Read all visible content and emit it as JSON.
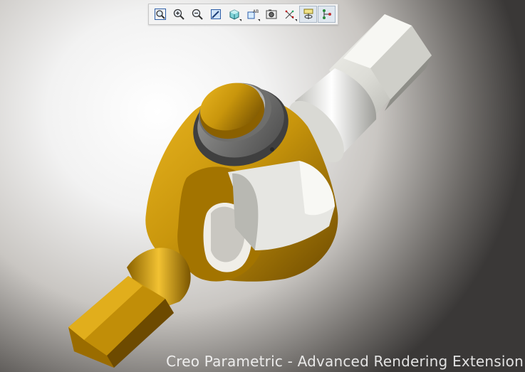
{
  "toolbar": {
    "buttons": [
      {
        "name": "refit-icon",
        "active": false,
        "dropdown": false
      },
      {
        "name": "zoom-in-icon",
        "active": false,
        "dropdown": false
      },
      {
        "name": "zoom-out-icon",
        "active": false,
        "dropdown": false
      },
      {
        "name": "repaint-icon",
        "active": false,
        "dropdown": false
      },
      {
        "name": "display-style-icon",
        "active": false,
        "dropdown": true
      },
      {
        "name": "saved-orientations-icon",
        "active": false,
        "dropdown": true
      },
      {
        "name": "view-manager-icon",
        "active": false,
        "dropdown": false
      },
      {
        "name": "datum-display-icon",
        "active": false,
        "dropdown": true
      },
      {
        "name": "spin-center-icon",
        "active": true,
        "dropdown": false
      },
      {
        "name": "mechanism-connections-icon",
        "active": true,
        "dropdown": false
      }
    ]
  },
  "watermark": "Creo Parametric - Advanced Rendering Extension",
  "colors": {
    "gold": "#c9960c",
    "gold_dark": "#7a5500",
    "silver": "#d8d8d4",
    "steel_dark": "#5a5a5a"
  }
}
